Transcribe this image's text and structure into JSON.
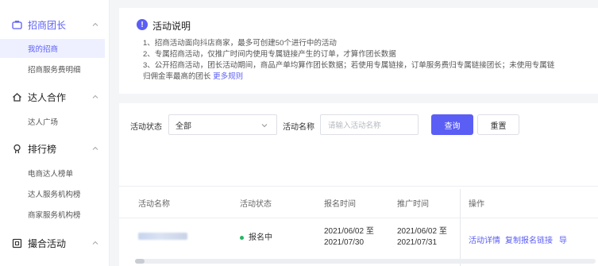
{
  "sidebar": {
    "groups": [
      {
        "label": "招商团长",
        "icon": "briefcase-icon",
        "active": true
      },
      {
        "label": "达人合作",
        "icon": "house-icon"
      },
      {
        "label": "排行榜",
        "icon": "medal-icon"
      },
      {
        "label": "撮合活动",
        "icon": "box-icon"
      }
    ],
    "items": [
      {
        "label": "我的招商"
      },
      {
        "label": "招商服务费明细"
      },
      {
        "label": "达人广场"
      },
      {
        "label": "电商达人榜单"
      },
      {
        "label": "达人服务机构榜"
      },
      {
        "label": "商家服务机构榜"
      }
    ]
  },
  "notice": {
    "title": "活动说明",
    "lines": [
      "1、招商活动面向抖店商家，最多可创建50个进行中的活动",
      "2、专属招商活动，仅推广时间内使用专属链接产生的订单，才算作团长数据",
      "3、公开招商活动，团长活动期间，商品产单均算作团长数据；若使用专属链接，订单服务费归专属链接团长；未使用专属链",
      "归佣金率最高的团长"
    ],
    "more_link": "更多规则"
  },
  "filters": {
    "status_label": "活动状态",
    "status_value": "全部",
    "name_label": "活动名称",
    "name_placeholder": "请输入活动名称",
    "search_button": "查询",
    "reset_button": "重置"
  },
  "table": {
    "headers": [
      "活动名称",
      "活动状态",
      "报名时间",
      "推广时间",
      "操作"
    ],
    "rows": [
      {
        "status": "报名中",
        "signup_start": "2021/06/02 至",
        "signup_end": "2021/07/30",
        "promo_start": "2021/06/02 至",
        "promo_end": "2021/07/31",
        "actions": [
          "活动详情",
          "复制报名链接",
          "导"
        ]
      }
    ]
  },
  "colors": {
    "accent": "#5b5ef5",
    "status_green": "#28b463"
  }
}
